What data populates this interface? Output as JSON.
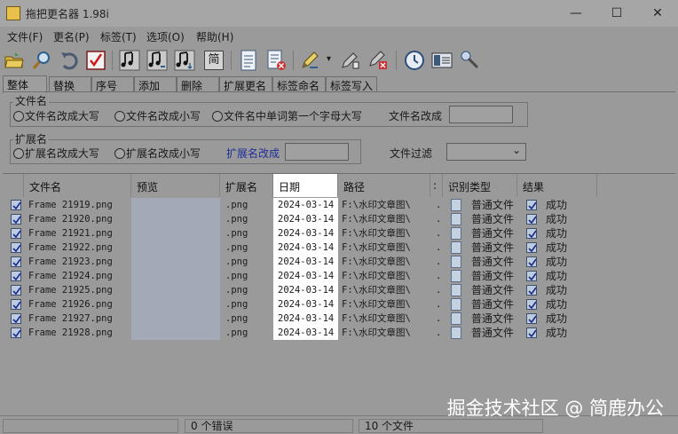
{
  "window": {
    "title": "拖把更名器 1.98i",
    "minimize_glyph": "—",
    "maximize_glyph": "☐",
    "close_glyph": "✕"
  },
  "menu": [
    "文件(F)",
    "更名(P)",
    "标签(T)",
    "选项(O)",
    "帮助(H)"
  ],
  "toolbar": {
    "icons": [
      "open-folder-icon",
      "search-icon",
      "undo-icon",
      "apply-rename-icon",
      "music-tag-1-icon",
      "music-tag-2-icon",
      "music-tag-3-icon",
      "simplified-icon",
      "document-list-icon",
      "document-delete-icon",
      "pen-edit-icon",
      "dropdown-arrow-icon",
      "quick-tag-icon",
      "tag-delete-icon",
      "clock-icon",
      "panel-toggle-icon",
      "pin-tool-icon"
    ],
    "simplified_label": "简",
    "dropdown_glyph": "▾"
  },
  "tabs": [
    "整体",
    "替换",
    "序号",
    "添加",
    "删除",
    "扩展更名",
    "标签命名",
    "标签写入"
  ],
  "active_tab": "整体",
  "filename_group": {
    "label": "文件名",
    "options": [
      "文件名改成大写",
      "文件名改成小写",
      "文件名中单词第一个字母大写"
    ],
    "rename_label": "文件名改成",
    "rename_value": ""
  },
  "extension_group": {
    "label": "扩展名",
    "options": [
      "扩展名改成大写",
      "扩展名改成小写"
    ],
    "rename_label": "扩展名改成",
    "rename_value": ""
  },
  "file_filter": {
    "label": "文件过滤",
    "value": "",
    "arrow": "⌄"
  },
  "columns": [
    "文件名",
    "预览",
    "扩展名",
    "日期",
    "路径",
    ":",
    "识别类型",
    "结果"
  ],
  "files": [
    {
      "name": "Frame 21919.png",
      "ext": ".png",
      "date": "2024-03-14",
      "path": "F:\\水印文章图\\",
      "dot": ".",
      "type": "普通文件",
      "result": "成功"
    },
    {
      "name": "Frame 21920.png",
      "ext": ".png",
      "date": "2024-03-14",
      "path": "F:\\水印文章图\\",
      "dot": ".",
      "type": "普通文件",
      "result": "成功"
    },
    {
      "name": "Frame 21921.png",
      "ext": ".png",
      "date": "2024-03-14",
      "path": "F:\\水印文章图\\",
      "dot": ".",
      "type": "普通文件",
      "result": "成功"
    },
    {
      "name": "Frame 21922.png",
      "ext": ".png",
      "date": "2024-03-14",
      "path": "F:\\水印文章图\\",
      "dot": ".",
      "type": "普通文件",
      "result": "成功"
    },
    {
      "name": "Frame 21923.png",
      "ext": ".png",
      "date": "2024-03-14",
      "path": "F:\\水印文章图\\",
      "dot": ".",
      "type": "普通文件",
      "result": "成功"
    },
    {
      "name": "Frame 21924.png",
      "ext": ".png",
      "date": "2024-03-14",
      "path": "F:\\水印文章图\\",
      "dot": ".",
      "type": "普通文件",
      "result": "成功"
    },
    {
      "name": "Frame 21925.png",
      "ext": ".png",
      "date": "2024-03-14",
      "path": "F:\\水印文章图\\",
      "dot": ".",
      "type": "普通文件",
      "result": "成功"
    },
    {
      "name": "Frame 21926.png",
      "ext": ".png",
      "date": "2024-03-14",
      "path": "F:\\水印文章图\\",
      "dot": ".",
      "type": "普通文件",
      "result": "成功"
    },
    {
      "name": "Frame 21927.png",
      "ext": ".png",
      "date": "2024-03-14",
      "path": "F:\\水印文章图\\",
      "dot": ".",
      "type": "普通文件",
      "result": "成功"
    },
    {
      "name": "Frame 21928.png",
      "ext": ".png",
      "date": "2024-03-14",
      "path": "F:\\水印文章图\\",
      "dot": ".",
      "type": "普通文件",
      "result": "成功"
    }
  ],
  "status": {
    "errors": "0 个错误",
    "files": "10 个文件"
  },
  "watermark": "掘金技术社区 @ 简鹿办公",
  "colors": {
    "link": "#1f2f9a",
    "check_fill": "#bccbdf",
    "highlight": "#ffffff"
  }
}
